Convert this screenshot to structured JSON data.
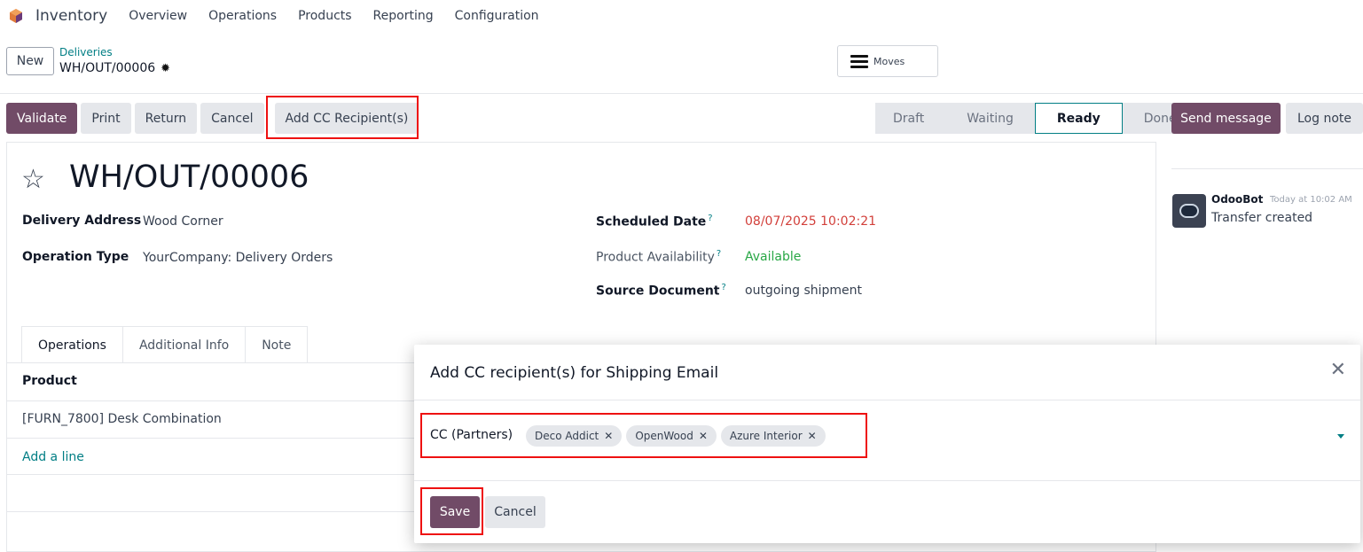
{
  "topnav": {
    "app_name": "Inventory",
    "menu": [
      "Overview",
      "Operations",
      "Products",
      "Reporting",
      "Configuration"
    ]
  },
  "control": {
    "new_label": "New",
    "breadcrumb_parent": "Deliveries",
    "breadcrumb_current": "WH/OUT/00006",
    "moves_label": "Moves"
  },
  "actions": {
    "validate": "Validate",
    "print": "Print",
    "return": "Return",
    "cancel": "Cancel",
    "add_cc": "Add CC Recipient(s)"
  },
  "statusbar": {
    "stages": [
      "Draft",
      "Waiting",
      "Ready",
      "Done"
    ],
    "active": "Ready"
  },
  "chatter": {
    "send_message": "Send message",
    "log_note": "Log note",
    "message": {
      "author": "OdooBot",
      "time": "Today at 10:02 AM",
      "body": "Transfer created"
    }
  },
  "form": {
    "title": "WH/OUT/00006",
    "delivery_address_label": "Delivery Address",
    "delivery_address": "Wood Corner",
    "operation_type_label": "Operation Type",
    "operation_type": "YourCompany: Delivery Orders",
    "scheduled_date_label": "Scheduled Date",
    "scheduled_date": "08/07/2025 10:02:21",
    "product_availability_label": "Product Availability",
    "product_availability": "Available",
    "source_document_label": "Source Document",
    "source_document": "outgoing shipment",
    "help_mark": "?",
    "tabs": [
      "Operations",
      "Additional Info",
      "Note"
    ],
    "product_header": "Product",
    "product_line": "[FURN_7800] Desk Combination",
    "add_line": "Add a line"
  },
  "modal": {
    "title": "Add CC recipient(s) for Shipping Email",
    "cc_label": "CC (Partners)",
    "partners": [
      "Deco Addict",
      "OpenWood",
      "Azure Interior"
    ],
    "save": "Save",
    "cancel": "Cancel"
  },
  "colors": {
    "primary": "#714b67",
    "accent": "#017e84",
    "date_overdue": "#d23f3a",
    "available": "#28a745",
    "highlight": "#ee1111"
  }
}
